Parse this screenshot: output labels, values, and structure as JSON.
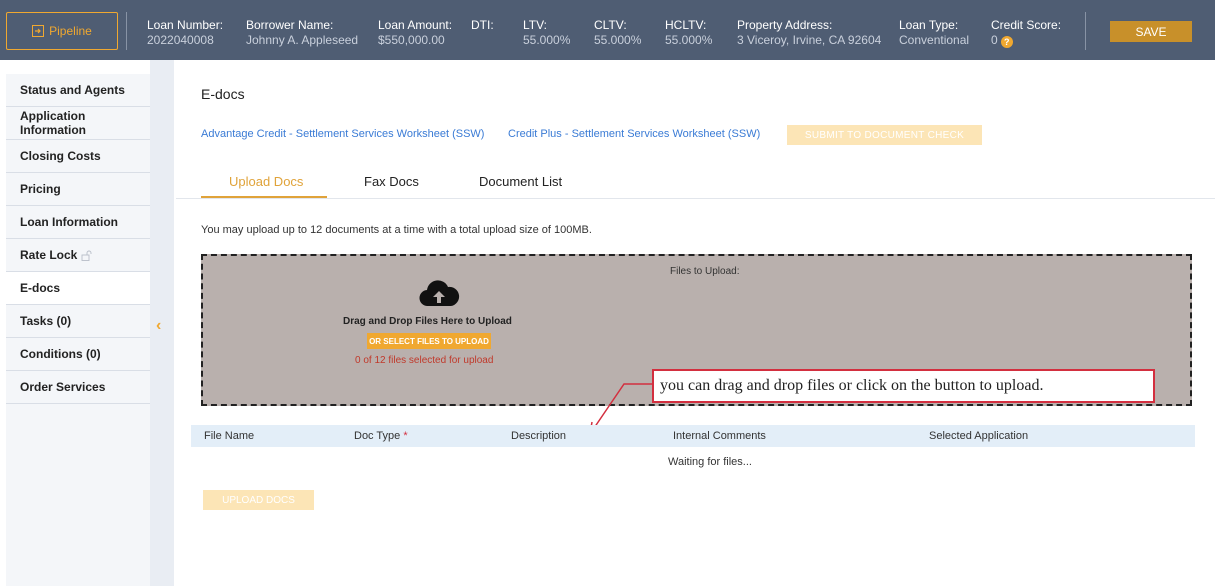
{
  "header": {
    "pipeline_label": "Pipeline",
    "fields": [
      {
        "label": "Loan Number:",
        "value": "2022040008"
      },
      {
        "label": "Borrower Name:",
        "value": "Johnny A. Appleseed"
      },
      {
        "label": "Loan Amount:",
        "value": "$550,000.00"
      },
      {
        "label": "DTI:",
        "value": ""
      },
      {
        "label": "LTV:",
        "value": "55.000%"
      },
      {
        "label": "CLTV:",
        "value": "55.000%"
      },
      {
        "label": "HCLTV:",
        "value": "55.000%"
      },
      {
        "label": "Property Address:",
        "value": "3 Viceroy, Irvine, CA 92604"
      },
      {
        "label": "Loan Type:",
        "value": "Conventional"
      },
      {
        "label": "Credit Score:",
        "value": "0"
      }
    ],
    "help_icon": "question-icon",
    "save_label": "SAVE",
    "accent_color": "#f0a830",
    "bar_color": "#4f5d73"
  },
  "sidebar": {
    "items": [
      {
        "label": "Status and Agents"
      },
      {
        "label": "Application Information"
      },
      {
        "label": "Closing Costs"
      },
      {
        "label": "Pricing"
      },
      {
        "label": "Loan Information"
      },
      {
        "label": "Rate Lock"
      },
      {
        "label": "E-docs",
        "active": true
      },
      {
        "label": "Tasks (0)"
      },
      {
        "label": "Conditions (0)"
      },
      {
        "label": "Order Services"
      }
    ],
    "collapse_icon": "chevron-left-icon"
  },
  "main": {
    "title": "E-docs",
    "links": [
      "Advantage Credit - Settlement Services Worksheet (SSW)",
      "Credit Plus - Settlement Services Worksheet (SSW)"
    ],
    "submit_label": "SUBMIT TO DOCUMENT CHECK",
    "tabs": [
      {
        "label": "Upload Docs",
        "active": true
      },
      {
        "label": "Fax Docs"
      },
      {
        "label": "Document List"
      }
    ],
    "upload_info": "You may upload up to 12 documents at a time with a total upload size of 100MB.",
    "dropzone": {
      "files_label": "Files to Upload:",
      "drag_text": "Drag and Drop Files Here to Upload",
      "select_label": "OR SELECT FILES TO UPLOAD",
      "count_text": "0 of 12 files selected for upload",
      "icon": "cloud-upload-icon"
    },
    "callout": "you can drag and drop files or click on the button to upload.",
    "table": {
      "columns": [
        "File Name",
        "Doc Type",
        "Description",
        "Internal Comments",
        "Selected Application"
      ],
      "required_marker": "*",
      "empty_text": "Waiting for files..."
    },
    "upload_label": "UPLOAD DOCS"
  }
}
